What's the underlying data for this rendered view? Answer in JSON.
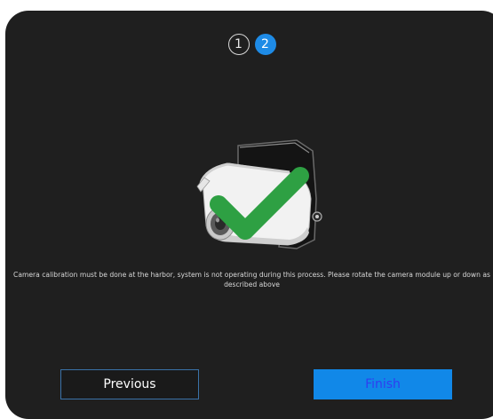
{
  "stepper": {
    "steps": [
      {
        "label": "1",
        "state": "inactive"
      },
      {
        "label": "2",
        "state": "active"
      }
    ]
  },
  "illustration": {
    "icon": "camera-icon",
    "overlay": "checkmark-icon",
    "check_color": "#2ea043"
  },
  "message": {
    "text": "Camera calibration must be done at the harbor, system is not operating during this process. Please rotate the camera module up or down as described above"
  },
  "actions": {
    "previous_label": "Previous",
    "finish_label": "Finish"
  },
  "colors": {
    "background": "#1f1f1f",
    "accent": "#1188e8",
    "finish_text": "#2f3ef0"
  }
}
